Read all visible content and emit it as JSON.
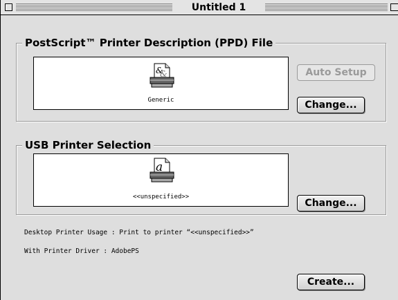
{
  "window": {
    "title": "Untitled 1"
  },
  "ppd_group": {
    "title": "PostScript™ Printer Description (PPD) File",
    "well_label": "Generic",
    "auto_setup_label": "Auto Setup",
    "change_label": "Change..."
  },
  "usb_group": {
    "title": "USB Printer Selection",
    "well_label": "<<unspecified>>",
    "change_label": "Change..."
  },
  "info": {
    "usage_line": "Desktop Printer Usage : Print to printer “<<unspecified>>”",
    "driver_line": "With Printer Driver : AdobePS"
  },
  "create_label": "Create...",
  "icons": {
    "ppd": "generic-printer-icon",
    "usb": "printer-a-icon",
    "close": "close-box-icon",
    "zoom": "zoom-box-icon"
  }
}
